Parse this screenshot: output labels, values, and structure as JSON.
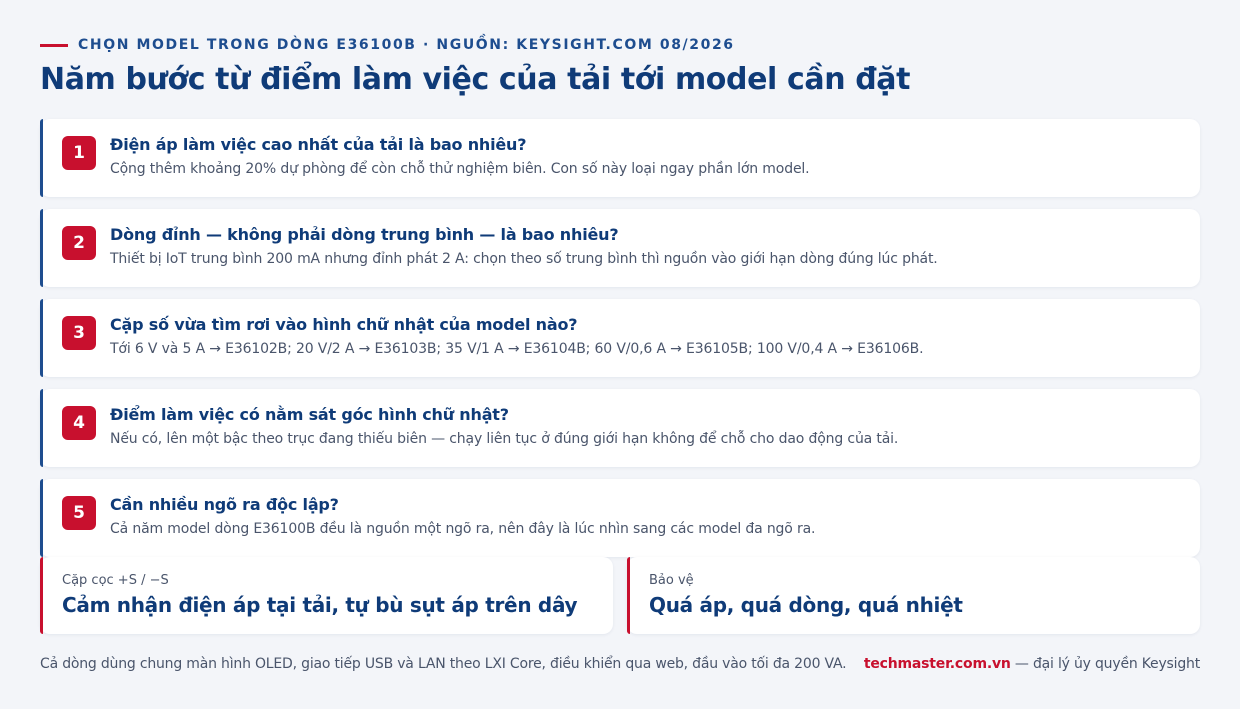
{
  "header": {
    "eyebrow": "CHỌN MODEL TRONG DÒNG E36100B · NGUỒN: KEYSIGHT.COM 08/2026",
    "title": "Năm bước từ điểm làm việc của tải tới model cần đặt"
  },
  "steps": [
    {
      "number": "1",
      "question": "Điện áp làm việc cao nhất của tải là bao nhiêu?",
      "answer": "Cộng thêm khoảng 20% dự phòng để còn chỗ thử nghiệm biên. Con số này loại ngay phần lớn model."
    },
    {
      "number": "2",
      "question": "Dòng đỉnh — không phải dòng trung bình — là bao nhiêu?",
      "answer": "Thiết bị IoT trung bình 200 mA nhưng đỉnh phát 2 A: chọn theo số trung bình thì nguồn vào giới hạn dòng đúng lúc phát."
    },
    {
      "number": "3",
      "question": "Cặp số vừa tìm rơi vào hình chữ nhật của model nào?",
      "answer": "Tới 6 V và 5 A → E36102B; 20 V/2 A → E36103B; 35 V/1 A → E36104B; 60 V/0,6 A → E36105B; 100 V/0,4 A → E36106B."
    },
    {
      "number": "4",
      "question": "Điểm làm việc có nằm sát góc hình chữ nhật?",
      "answer": "Nếu có, lên một bậc theo trục đang thiếu biên — chạy liên tục ở đúng giới hạn không để chỗ cho dao động của tải."
    },
    {
      "number": "5",
      "question": "Cần nhiều ngõ ra độc lập?",
      "answer": "Cả năm model dòng E36100B đều là nguồn một ngõ ra, nên đây là lúc nhìn sang các model đa ngõ ra."
    }
  ],
  "features": [
    {
      "label": "Cặp cọc +S / −S",
      "value": "Cảm nhận điện áp tại tải, tự bù sụt áp trên dây"
    },
    {
      "label": "Bảo vệ",
      "value": "Quá áp, quá dòng, quá nhiệt"
    }
  ],
  "footer": {
    "note": "Cả dòng dùng chung màn hình OLED, giao tiếp USB và LAN theo LXI Core, điều khiển qua web, đầu vào tối đa 200 VA.",
    "brand": "techmaster.com.vn",
    "credit": " — đại lý ủy quyền Keysight"
  },
  "colors": {
    "accent_red": "#c8102e",
    "primary_blue": "#0f3b78",
    "background": "#f3f5f9"
  }
}
